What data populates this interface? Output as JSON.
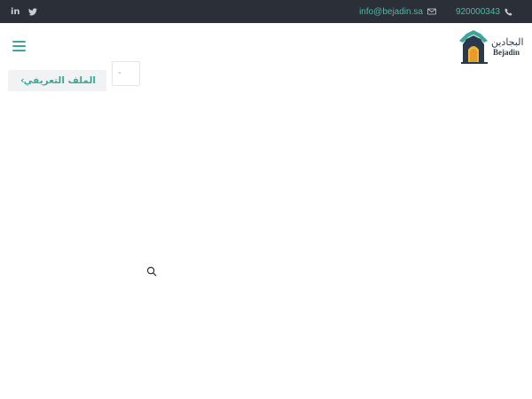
{
  "topbar": {
    "social": [
      {
        "name": "linkedin-icon",
        "glyph": "in"
      },
      {
        "name": "twitter-icon",
        "glyph": ""
      }
    ],
    "email": "info@bejadin.sa",
    "phone": "920000343"
  },
  "header": {
    "menu_icon": "hamburger-menu-icon",
    "logo": {
      "arabic": "البجادين",
      "english": "Bejadin"
    }
  },
  "profile_button": {
    "label": "الملف التعريفي",
    "chevron": "‹"
  },
  "dropdown": {
    "value": "",
    "caret": "⌄"
  },
  "colors": {
    "topbar_bg": "#2b2f38",
    "accent": "#3aa79a",
    "link": "#4fb8a8"
  }
}
